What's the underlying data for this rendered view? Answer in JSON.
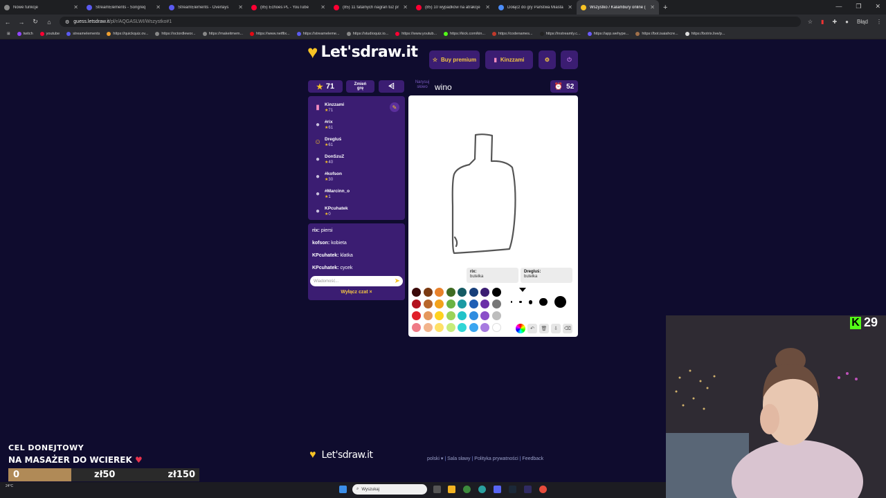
{
  "browser": {
    "tabs": [
      {
        "title": "Nowe funkcje",
        "color": "#8a8a8a",
        "active": false
      },
      {
        "title": "StreamElements - Songreq",
        "color": "#5a5af0",
        "active": false
      },
      {
        "title": "StreamElements - Overlays",
        "color": "#5a5af0",
        "active": false
      },
      {
        "title": "(85) Echoes PL - YouTube",
        "color": "#ff0033",
        "active": false
      },
      {
        "title": "(85) 11 fatalnych nagrań tuż pr",
        "color": "#ff0033",
        "active": false
      },
      {
        "title": "(85) 10 wypadków na atrakcje",
        "color": "#ff0033",
        "active": false
      },
      {
        "title": "Dołącz do gry Państwa Miasta",
        "color": "#4b8df8",
        "active": false
      },
      {
        "title": "Wszystko / Kalambury online (",
        "color": "#f7c325",
        "active": true
      }
    ],
    "url_host": "guess.letsdraw.it",
    "url_path": "/pl/r/AQGASLWI/Wszystko#1",
    "profile_label": "Błąd",
    "bookmarks": [
      {
        "label": "twitch",
        "color": "#9146ff"
      },
      {
        "label": "youtube",
        "color": "#ff0033"
      },
      {
        "label": "streamelements",
        "color": "#5a5af0"
      },
      {
        "label": "https://quickquiz.ov...",
        "color": "#f0a030"
      },
      {
        "label": "https://octordlewor...",
        "color": "#888888"
      },
      {
        "label": "https://makeitmem...",
        "color": "#888888"
      },
      {
        "label": "https://www.netflix...",
        "color": "#e50914"
      },
      {
        "label": "https://streameleme...",
        "color": "#5a5af0"
      },
      {
        "label": "https://studioquiz.io...",
        "color": "#888888"
      },
      {
        "label": "https://www.youtub...",
        "color": "#ff0033"
      },
      {
        "label": "https://kick.com/kin...",
        "color": "#53fc18"
      },
      {
        "label": "https://codenames...",
        "color": "#c0392b"
      },
      {
        "label": "https://instreamly.c...",
        "color": "#222222"
      },
      {
        "label": "https://app.wehype...",
        "color": "#6b5bff"
      },
      {
        "label": "https://bot.isaiahcre...",
        "color": "#a0704a"
      },
      {
        "label": "https://botrix.live/p...",
        "color": "#dddddd"
      }
    ]
  },
  "game": {
    "logo": "Let'sdraw.it",
    "buy_premium": "Buy premium",
    "user_name": "Kinzzami",
    "score": "71",
    "change_game": "Zmień grę",
    "word_label": "Narysuj słowo",
    "word": "wino",
    "timer": "52",
    "players": [
      {
        "name": "Kinzzami",
        "score": "71",
        "drawing": true,
        "avatar": "popsicle"
      },
      {
        "name": "#rix",
        "score": "61",
        "drawing": false,
        "avatar": "user"
      },
      {
        "name": "Dregluś",
        "score": "61",
        "drawing": false,
        "avatar": "angel"
      },
      {
        "name": "DonSzuZ",
        "score": "40",
        "drawing": false,
        "avatar": "user"
      },
      {
        "name": "#kofson",
        "score": "30",
        "drawing": false,
        "avatar": "user"
      },
      {
        "name": "#Marcinn_o",
        "score": "1",
        "drawing": false,
        "avatar": "user"
      },
      {
        "name": "KPcuhatek",
        "score": "0",
        "drawing": false,
        "avatar": "user"
      }
    ],
    "chat": [
      {
        "user": "rix:",
        "text": "piersi"
      },
      {
        "user": "kofson:",
        "text": "kobieta"
      },
      {
        "user": "KPcuhatek:",
        "text": "klatka"
      },
      {
        "user": "KPcuhatek:",
        "text": "cycek"
      }
    ],
    "chat_placeholder": "Wiadomość...",
    "chat_off": "Wyłącz czat ×",
    "guesses": [
      {
        "user": "rix:",
        "text": "butelka"
      },
      {
        "user": "Dregluś:",
        "text": "butelka"
      }
    ],
    "palette": [
      "#3b0a0a",
      "#7a3a12",
      "#e8822b",
      "#3f6b22",
      "#155a63",
      "#173f7a",
      "#3b1d72",
      "#000000",
      "#b3121f",
      "#b8662b",
      "#f3a21b",
      "#6ab344",
      "#1b9aa3",
      "#1f5fb5",
      "#6b2fa8",
      "#777777",
      "#e0212b",
      "#e5975d",
      "#ffd21f",
      "#9bd35a",
      "#22c3c9",
      "#2f8de0",
      "#8b4fc9",
      "#bdbdbd",
      "#ef7a86",
      "#f2b48c",
      "#ffe066",
      "#c6ec7a",
      "#30d6d6",
      "#3aa5f0",
      "#a77be0",
      "#ffffff"
    ],
    "brush_sizes": [
      2,
      3,
      5,
      10,
      15
    ],
    "footer_logo": "Let'sdraw.it",
    "footer_lang": "polski",
    "footer_links": [
      "Sala sławy",
      "Polityka prywatności",
      "Feedback"
    ]
  },
  "overlay": {
    "goal_title": "CEL DONEJTOWY",
    "goal_subtitle": "NA MASAŻER DO WCIEREK",
    "goal_start": "0",
    "goal_mid": "zł50",
    "goal_end": "zł150",
    "goal_progress": 0.33,
    "kick_viewers": "29",
    "weather": "24°C"
  },
  "taskbar": {
    "search_placeholder": "Wyszukaj"
  }
}
